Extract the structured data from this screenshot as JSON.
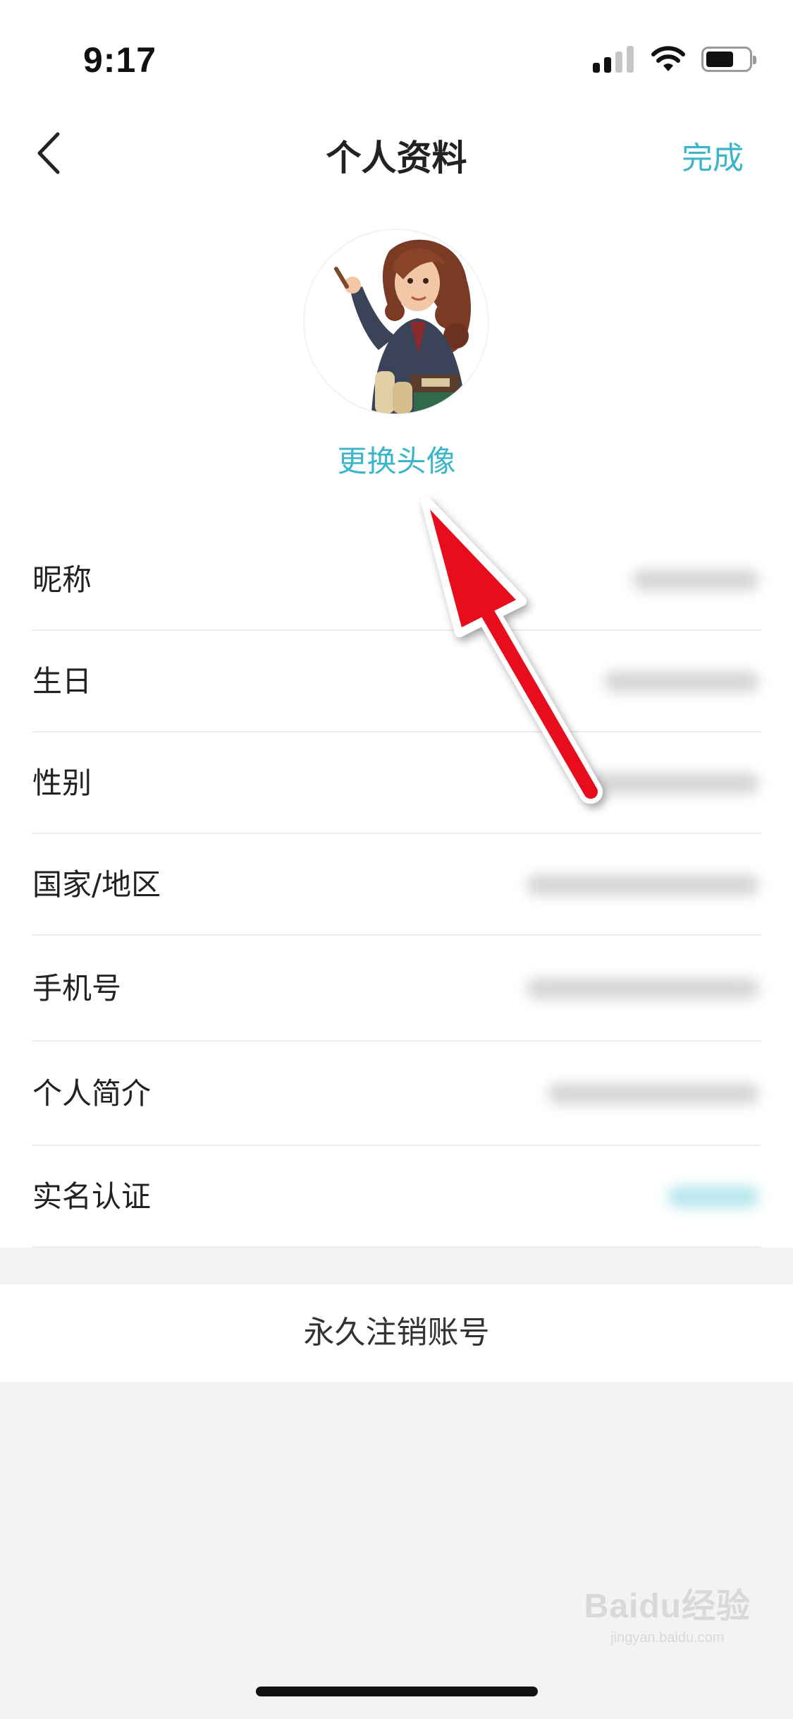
{
  "status_bar": {
    "time": "9:17",
    "icons": [
      "signal-icon",
      "wifi-icon",
      "battery-icon"
    ],
    "signal_bars_active": 2,
    "signal_bars_total": 4,
    "battery_level": 0.65
  },
  "nav": {
    "back_icon": "chevron-left-icon",
    "title": "个人资料",
    "done_label": "完成"
  },
  "profile": {
    "change_avatar_label": "更换头像"
  },
  "fields": [
    {
      "label": "昵称"
    },
    {
      "label": "生日"
    },
    {
      "label": "性别"
    },
    {
      "label": "国家/地区"
    },
    {
      "label": "手机号"
    },
    {
      "label": "个人简介"
    },
    {
      "label": "实名认证"
    }
  ],
  "delete_account_label": "永久注销账号",
  "watermark": {
    "brand": "Baidu经验",
    "domain": "jingyan.baidu.com"
  },
  "colors": {
    "accent": "#3bb5c9",
    "annotation_arrow": "#e8101e",
    "page_background": "#f3f3f3"
  }
}
